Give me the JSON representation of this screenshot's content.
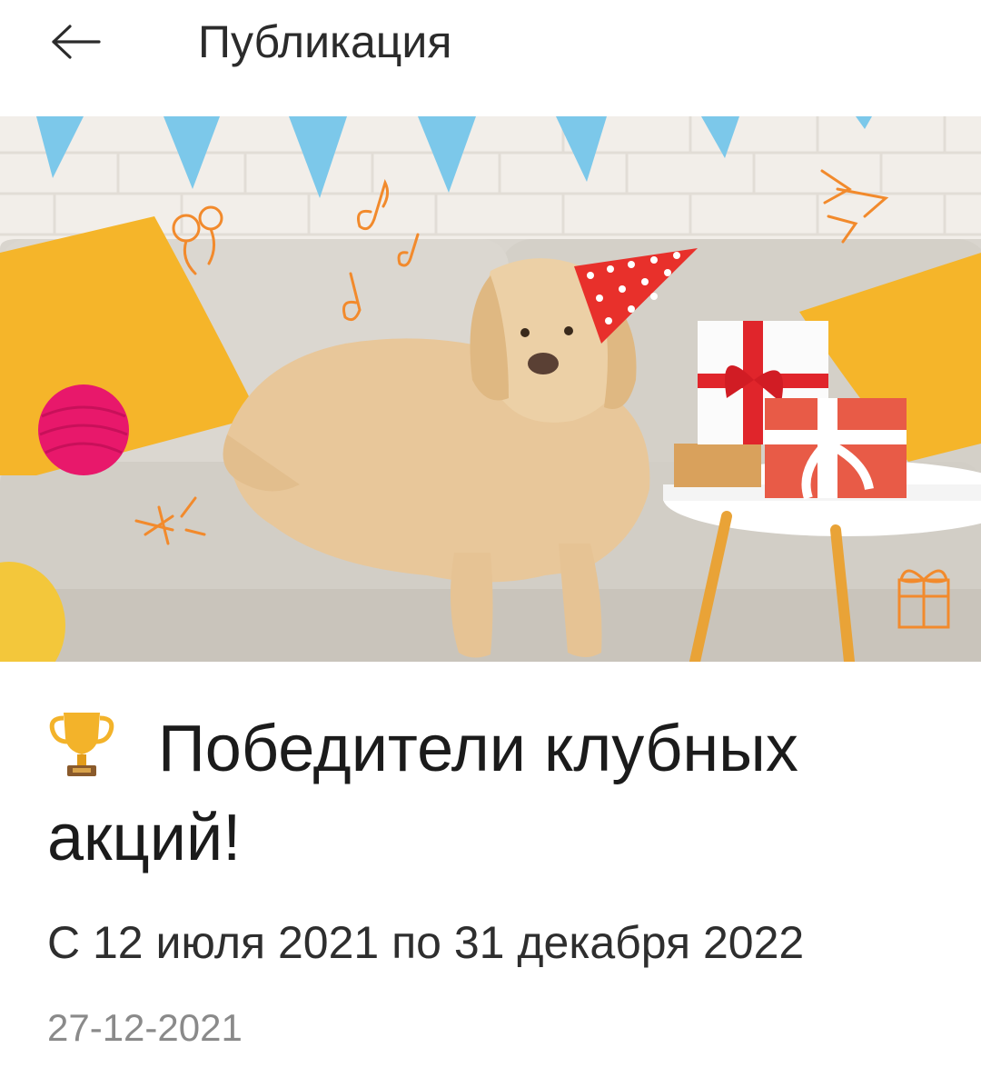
{
  "header": {
    "title": "Публикация",
    "back_icon": "arrow-left-icon"
  },
  "hero": {
    "icon": "party-dog-photo",
    "colors": {
      "wall": "#f2eee9",
      "sofa": "#d8d4cd",
      "pillow": "#f5b52a",
      "flag": "#7cc8ea",
      "party_hat": "#e8302b",
      "dog": "#e8c79a",
      "doodle": "#f28a2c"
    }
  },
  "post": {
    "title": "Победители клубных акций!",
    "title_icon": "trophy-icon",
    "period": "С 12 июля 2021 по 31 декабря 2022",
    "date": "27-12-2021"
  }
}
